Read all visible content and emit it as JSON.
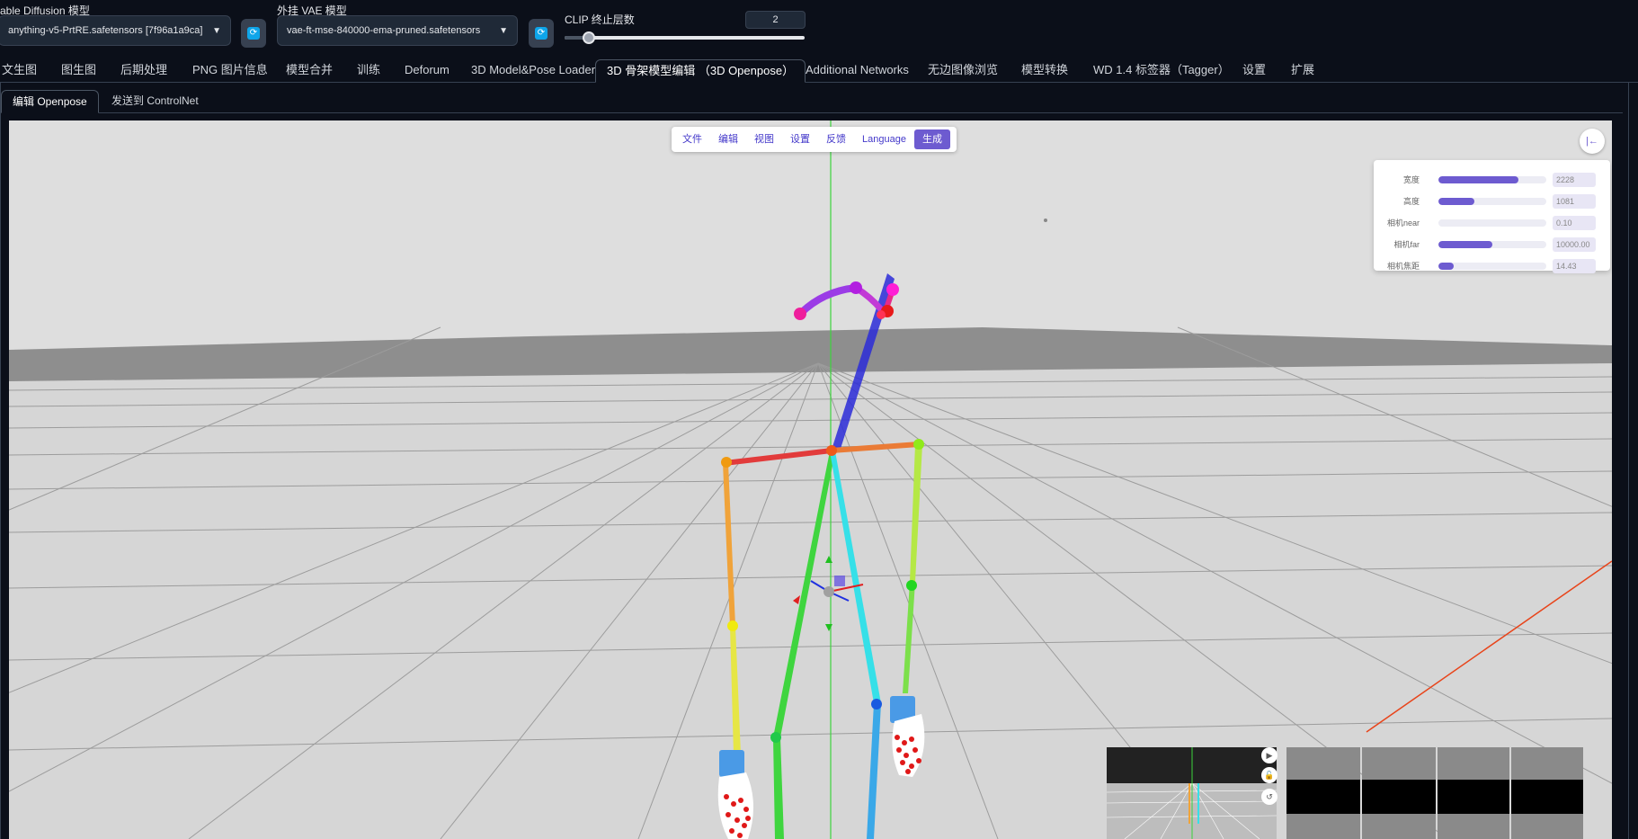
{
  "top": {
    "model_label": "able Diffusion 模型",
    "model_value": "anything-v5-PrtRE.safetensors [7f96a1a9ca]",
    "vae_label": "外挂 VAE 模型",
    "vae_value": "vae-ft-mse-840000-ema-pruned.safetensors",
    "clip_label": "CLIP 终止层数",
    "clip_value": "2",
    "clip_slider_fraction": 0.1
  },
  "tabs": [
    "文生图",
    "图生图",
    "后期处理",
    "PNG 图片信息",
    "模型合并",
    "训练",
    "Deforum",
    "3D Model&Pose Loader",
    "3D 骨架模型编辑 （3D Openpose）",
    "Additional Networks",
    "无边图像浏览",
    "模型转换",
    "WD 1.4 标签器（Tagger）",
    "设置",
    "扩展"
  ],
  "subtabs": [
    "编辑 Openpose",
    "发送到 ControlNet"
  ],
  "menu": [
    "文件",
    "编辑",
    "视图",
    "设置",
    "反馈",
    "Language",
    "生成"
  ],
  "collapse_icon": "collapse-left-icon",
  "properties": [
    {
      "label": "宽度",
      "value": "2228",
      "fraction": 0.74
    },
    {
      "label": "高度",
      "value": "1081",
      "fraction": 0.33
    },
    {
      "label": "相机near",
      "value": "0.10",
      "fraction": 0.0
    },
    {
      "label": "相机far",
      "value": "10000.00",
      "fraction": 0.5
    },
    {
      "label": "相机焦距",
      "value": "14.43",
      "fraction": 0.14
    }
  ],
  "thumb_buttons": [
    "play-icon",
    "lock-icon",
    "undo-icon"
  ],
  "colors": {
    "accent": "#6d5bd0",
    "background": "#0b0f19",
    "floor": "#dedede"
  }
}
